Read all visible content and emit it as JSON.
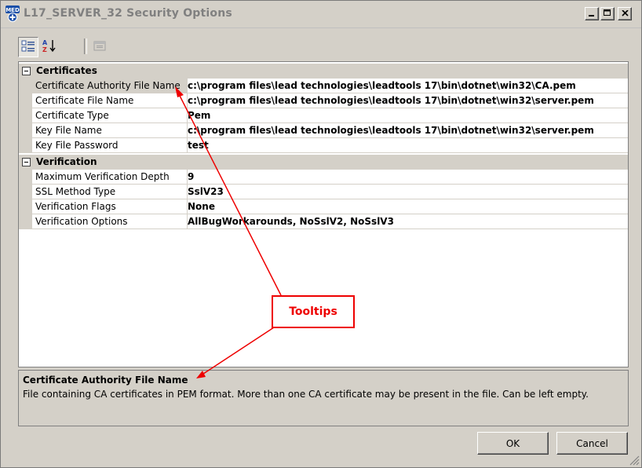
{
  "window": {
    "title": "L17_SERVER_32 Security Options",
    "app_icon_text": "MED",
    "controls": {
      "minimize": "_",
      "maximize": "□",
      "close": "×"
    }
  },
  "toolbar": {
    "buttons": [
      {
        "name": "categorized-icon",
        "pressed": true
      },
      {
        "name": "alphabetical-icon",
        "pressed": false
      },
      {
        "name": "property-pages-icon",
        "pressed": false
      }
    ]
  },
  "grid": {
    "categories": [
      {
        "label": "Certificates",
        "properties": [
          {
            "name": "Certificate Authority File Name",
            "value": "c:\\program files\\lead technologies\\leadtools 17\\bin\\dotnet\\win32\\CA.pem",
            "selected": true
          },
          {
            "name": "Certificate File Name",
            "value": "c:\\program files\\lead technologies\\leadtools 17\\bin\\dotnet\\win32\\server.pem"
          },
          {
            "name": "Certificate Type",
            "value": "Pem"
          },
          {
            "name": "Key File Name",
            "value": "c:\\program files\\lead technologies\\leadtools 17\\bin\\dotnet\\win32\\server.pem"
          },
          {
            "name": "Key File Password",
            "value": "test"
          }
        ]
      },
      {
        "label": "Verification",
        "properties": [
          {
            "name": "Maximum Verification Depth",
            "value": "9"
          },
          {
            "name": "SSL Method Type",
            "value": "SslV23"
          },
          {
            "name": "Verification Flags",
            "value": "None"
          },
          {
            "name": "Verification Options",
            "value": "AllBugWorkarounds, NoSslV2, NoSslV3"
          }
        ]
      }
    ]
  },
  "help": {
    "title": "Certificate Authority File Name",
    "description": "File containing CA certificates in PEM format. More than one CA certificate may be present in the file. Can be left empty."
  },
  "buttons": {
    "ok": "OK",
    "cancel": "Cancel"
  },
  "annotation": {
    "label": "Tooltips",
    "color": "#ee0000"
  }
}
